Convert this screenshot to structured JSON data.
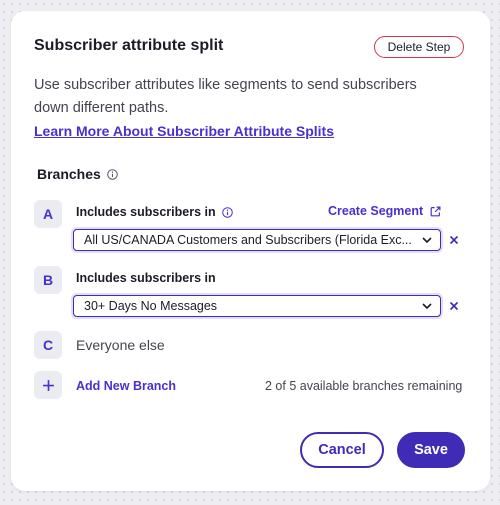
{
  "panel": {
    "title": "Subscriber attribute split",
    "delete_label": "Delete Step",
    "description": "Use subscriber attributes like segments to send subscribers down different paths.",
    "learn_more": "Learn More About Subscriber Attribute Splits"
  },
  "branches": {
    "heading": "Branches",
    "info_icon": "info-icon",
    "create_segment": "Create Segment",
    "create_segment_icon": "external-link-icon",
    "items": [
      {
        "letter": "A",
        "label": "Includes subscribers in",
        "selected": "All US/CANADA Customers and Subscribers (Florida Exc..."
      },
      {
        "letter": "B",
        "label": "Includes subscribers in",
        "selected": "30+ Days No Messages"
      },
      {
        "letter": "C",
        "label": "Everyone else"
      }
    ],
    "add_label": "Add New Branch",
    "remaining": "2 of 5 available branches remaining"
  },
  "footer": {
    "cancel": "Cancel",
    "save": "Save"
  },
  "colors": {
    "accent": "#3f2bb5",
    "link": "#4b2fd1",
    "danger": "#d9324a"
  }
}
